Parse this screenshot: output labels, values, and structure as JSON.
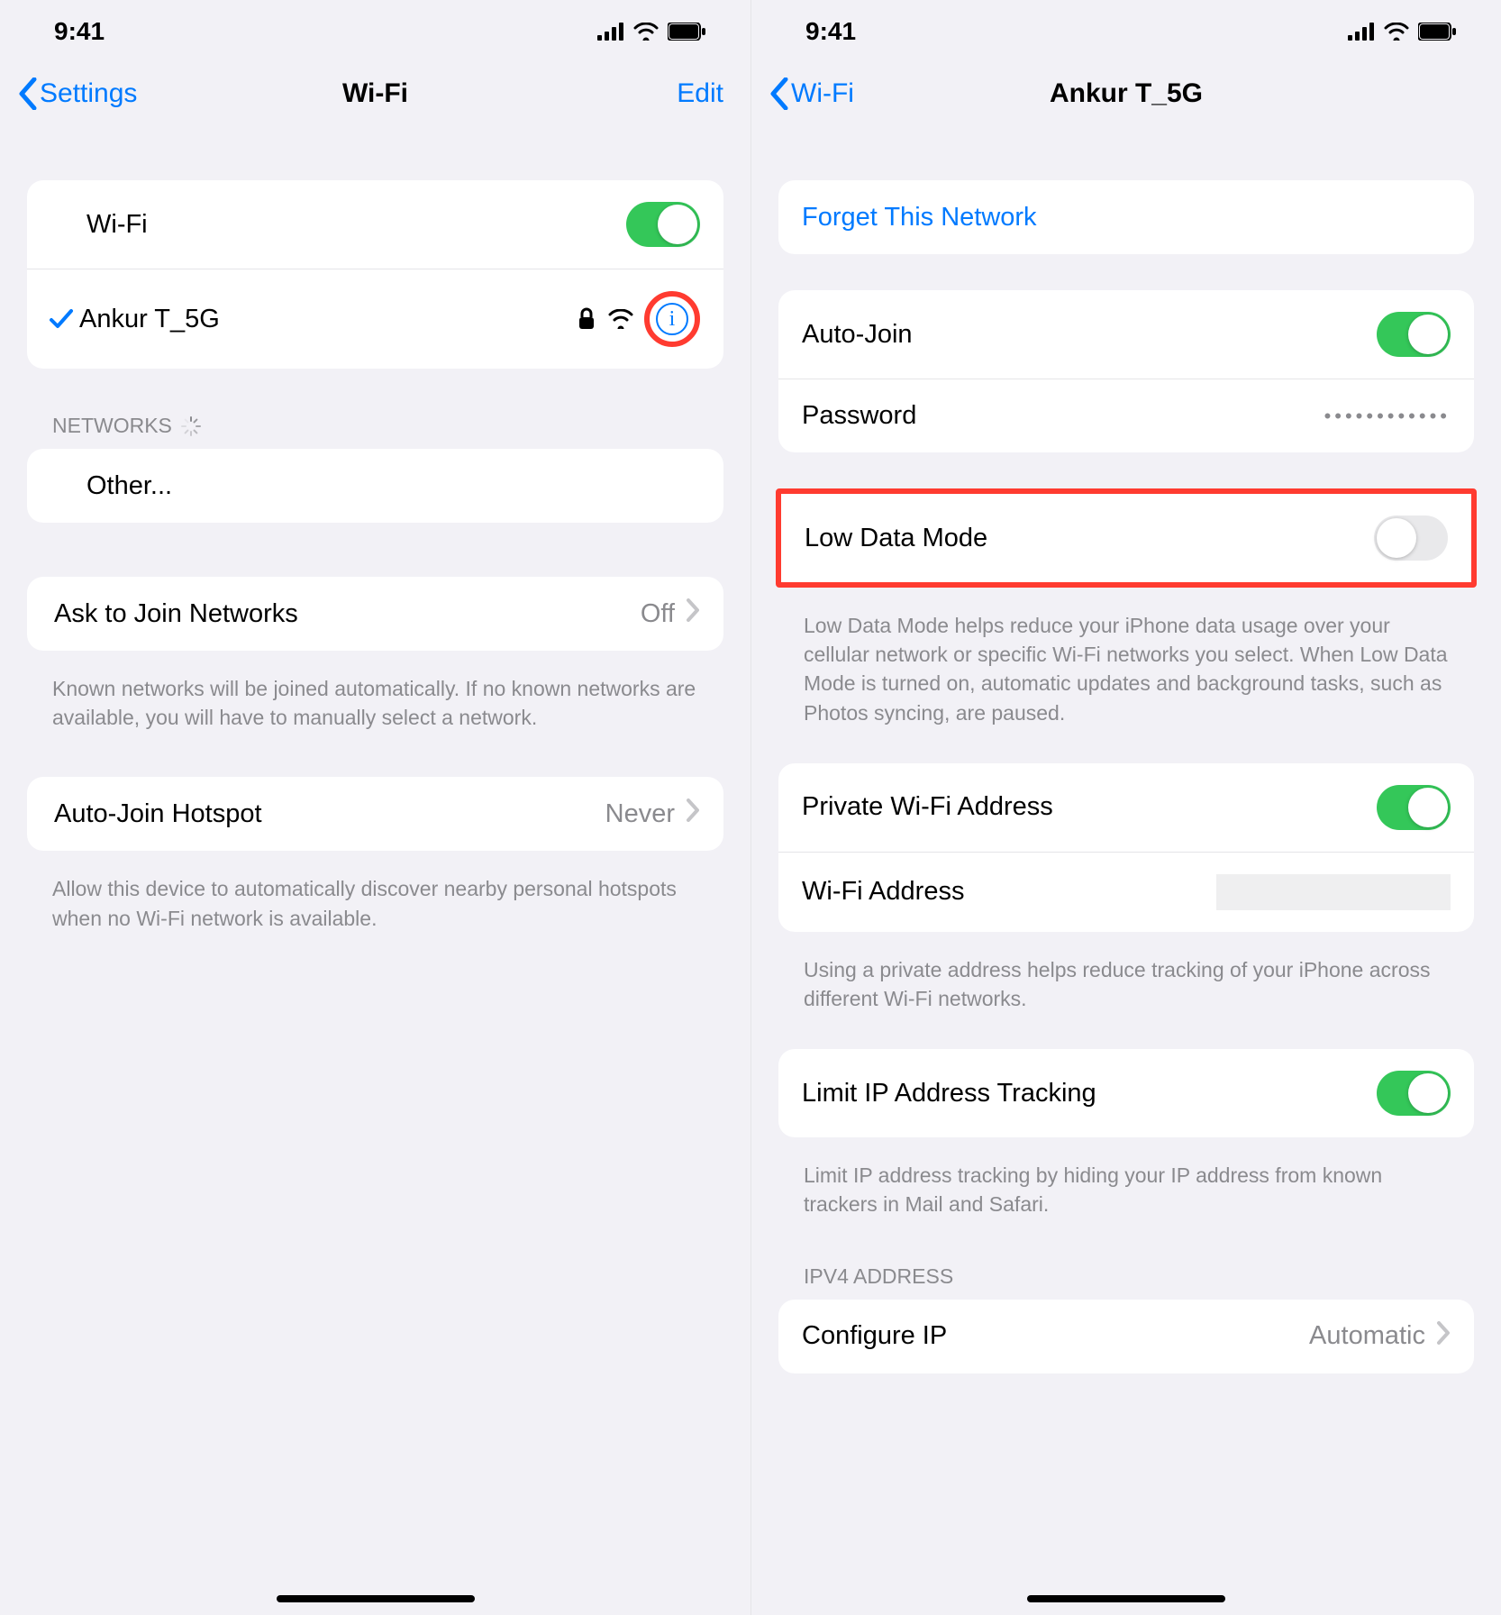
{
  "statusTime": "9:41",
  "left": {
    "backLabel": "Settings",
    "title": "Wi-Fi",
    "editLabel": "Edit",
    "wifiLabel": "Wi-Fi",
    "currentNetwork": "Ankur T_5G",
    "networksHeader": "NETWORKS",
    "otherLabel": "Other...",
    "askLabel": "Ask to Join Networks",
    "askValue": "Off",
    "askFooter": "Known networks will be joined automatically. If no known networks are available, you will have to manually select a network.",
    "hotspotLabel": "Auto-Join Hotspot",
    "hotspotValue": "Never",
    "hotspotFooter": "Allow this device to automatically discover nearby personal hotspots when no Wi-Fi network is available."
  },
  "right": {
    "backLabel": "Wi-Fi",
    "title": "Ankur T_5G",
    "forgetLabel": "Forget This Network",
    "autoJoinLabel": "Auto-Join",
    "passwordLabel": "Password",
    "passwordDots": "••••••••••••",
    "lowDataLabel": "Low Data Mode",
    "lowDataFooter": "Low Data Mode helps reduce your iPhone data usage over your cellular network or specific Wi-Fi networks you select. When Low Data Mode is turned on, automatic updates and background tasks, such as Photos syncing, are paused.",
    "privateAddrLabel": "Private Wi-Fi Address",
    "wifiAddrLabel": "Wi-Fi Address",
    "privateFooter": "Using a private address helps reduce tracking of your iPhone across different Wi-Fi networks.",
    "limitIPLabel": "Limit IP Address Tracking",
    "limitIPFooter": "Limit IP address tracking by hiding your IP address from known trackers in Mail and Safari.",
    "ipv4Header": "IPV4 ADDRESS",
    "configureIPLabel": "Configure IP",
    "configureIPValue": "Automatic"
  }
}
